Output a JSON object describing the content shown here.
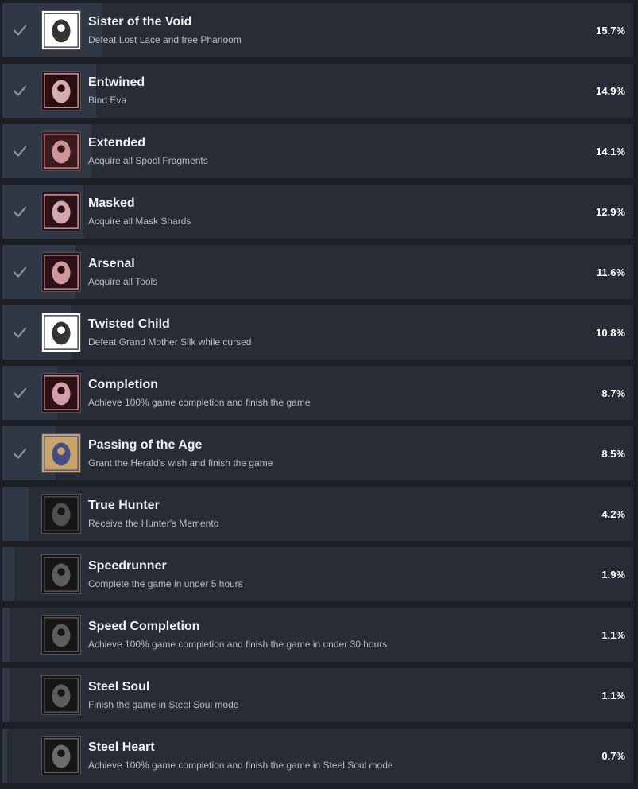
{
  "achievements": [
    {
      "name": "Sister of the Void",
      "description": "Defeat Lost Lace and free Pharloom",
      "percent": "15.7%",
      "percent_value": 15.7,
      "unlocked": true,
      "icon": "void-sister-icon",
      "icon_bg": "#ffffff",
      "icon_fg": "#111111"
    },
    {
      "name": "Entwined",
      "description": "Bind Eva",
      "percent": "14.9%",
      "percent_value": 14.9,
      "unlocked": true,
      "icon": "entwined-spider-icon",
      "icon_bg": "#2a0e12",
      "icon_fg": "#f3c8cc"
    },
    {
      "name": "Extended",
      "description": "Acquire all Spool Fragments",
      "percent": "14.1%",
      "percent_value": 14.1,
      "unlocked": true,
      "icon": "spool-icon",
      "icon_bg": "#3a1a1f",
      "icon_fg": "#e8aab0"
    },
    {
      "name": "Masked",
      "description": "Acquire all Mask Shards",
      "percent": "12.9%",
      "percent_value": 12.9,
      "unlocked": true,
      "icon": "mask-shard-icon",
      "icon_bg": "#2e1116",
      "icon_fg": "#f0c2c6"
    },
    {
      "name": "Arsenal",
      "description": "Acquire all Tools",
      "percent": "11.6%",
      "percent_value": 11.6,
      "unlocked": true,
      "icon": "tools-icon",
      "icon_bg": "#2e1116",
      "icon_fg": "#e9b2b8"
    },
    {
      "name": "Twisted Child",
      "description": "Defeat Grand Mother Silk while cursed",
      "percent": "10.8%",
      "percent_value": 10.8,
      "unlocked": true,
      "icon": "twisted-child-icon",
      "icon_bg": "#ffffff",
      "icon_fg": "#111111"
    },
    {
      "name": "Completion",
      "description": "Achieve 100% game completion and finish the game",
      "percent": "8.7%",
      "percent_value": 8.7,
      "unlocked": true,
      "icon": "completion-icon",
      "icon_bg": "#2e1116",
      "icon_fg": "#f0b8c0"
    },
    {
      "name": "Passing of the Age",
      "description": "Grant the Herald's wish and finish the game",
      "percent": "8.5%",
      "percent_value": 8.5,
      "unlocked": true,
      "icon": "herald-icon",
      "icon_bg": "#c9a46a",
      "icon_fg": "#2d3f8a"
    },
    {
      "name": "True Hunter",
      "description": "Receive the Hunter's Memento",
      "percent": "4.2%",
      "percent_value": 4.2,
      "unlocked": false,
      "icon": "hunter-memento-icon",
      "icon_bg": "#161616",
      "icon_fg": "#5a5a5a"
    },
    {
      "name": "Speedrunner",
      "description": "Complete the game in under 5 hours",
      "percent": "1.9%",
      "percent_value": 1.9,
      "unlocked": false,
      "icon": "speedrunner-icon",
      "icon_bg": "#161616",
      "icon_fg": "#6a6a6a"
    },
    {
      "name": "Speed Completion",
      "description": "Achieve 100% game completion and finish the game in under 30 hours",
      "percent": "1.1%",
      "percent_value": 1.1,
      "unlocked": false,
      "icon": "speed-completion-icon",
      "icon_bg": "#161616",
      "icon_fg": "#6a6a6a"
    },
    {
      "name": "Steel Soul",
      "description": "Finish the game in Steel Soul mode",
      "percent": "1.1%",
      "percent_value": 1.1,
      "unlocked": false,
      "icon": "steel-soul-icon",
      "icon_bg": "#161616",
      "icon_fg": "#6a6a6a"
    },
    {
      "name": "Steel Heart",
      "description": "Achieve 100% game completion and finish the game in Steel Soul mode",
      "percent": "0.7%",
      "percent_value": 0.7,
      "unlocked": false,
      "icon": "steel-heart-icon",
      "icon_bg": "#161616",
      "icon_fg": "#7a7a7a"
    }
  ],
  "colors": {
    "row_bg": "#272c36",
    "progress_fill": "#313845",
    "checkmark": "#8b929c"
  }
}
